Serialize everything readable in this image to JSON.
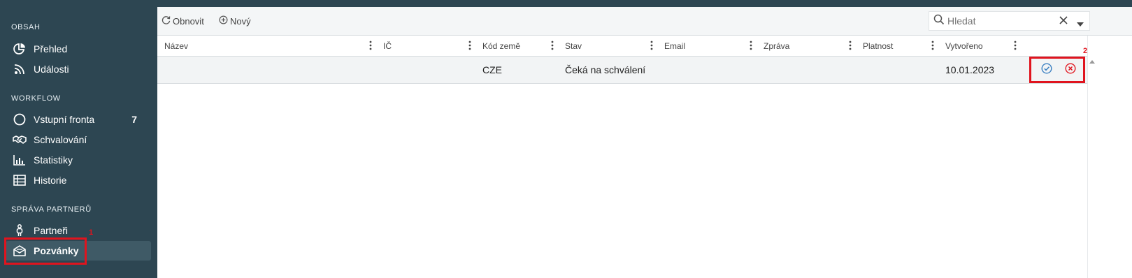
{
  "sidebar": {
    "sections": [
      {
        "title": "OBSAH",
        "items": [
          {
            "label": "Přehled",
            "icon": "pie-chart-icon"
          },
          {
            "label": "Události",
            "icon": "rss-icon"
          }
        ]
      },
      {
        "title": "WORKFLOW",
        "items": [
          {
            "label": "Vstupní fronta",
            "icon": "circle-icon",
            "badge": "7"
          },
          {
            "label": "Schvalování",
            "icon": "handshake-icon"
          },
          {
            "label": "Statistiky",
            "icon": "bar-chart-icon"
          },
          {
            "label": "Historie",
            "icon": "table-icon"
          }
        ]
      },
      {
        "title": "SPRÁVA PARTNERŮ",
        "items": [
          {
            "label": "Partneři",
            "icon": "person-icon"
          },
          {
            "label": "Pozvánky",
            "icon": "envelope-open-icon",
            "active": true
          }
        ]
      }
    ]
  },
  "annotations": {
    "marker1": "1",
    "marker2": "2",
    "color": "#e0141e"
  },
  "toolbar": {
    "refresh_label": "Obnovit",
    "new_label": "Nový",
    "search_placeholder": "Hledat"
  },
  "table": {
    "columns": [
      "Název",
      "IČ",
      "Kód země",
      "Stav",
      "Email",
      "Zpráva",
      "Platnost",
      "Vytvořeno"
    ],
    "rows": [
      {
        "nazev": "",
        "ic": "",
        "kod_zeme": "CZE",
        "stav": "Čeká na schválení",
        "email": "",
        "zprava": "",
        "platnost": "",
        "vytvoreno": "10.01.2023"
      }
    ]
  },
  "colors": {
    "sidebar_bg": "#2d4652",
    "accent_blue": "#3a7fc1",
    "reject_red": "#e0141e"
  }
}
